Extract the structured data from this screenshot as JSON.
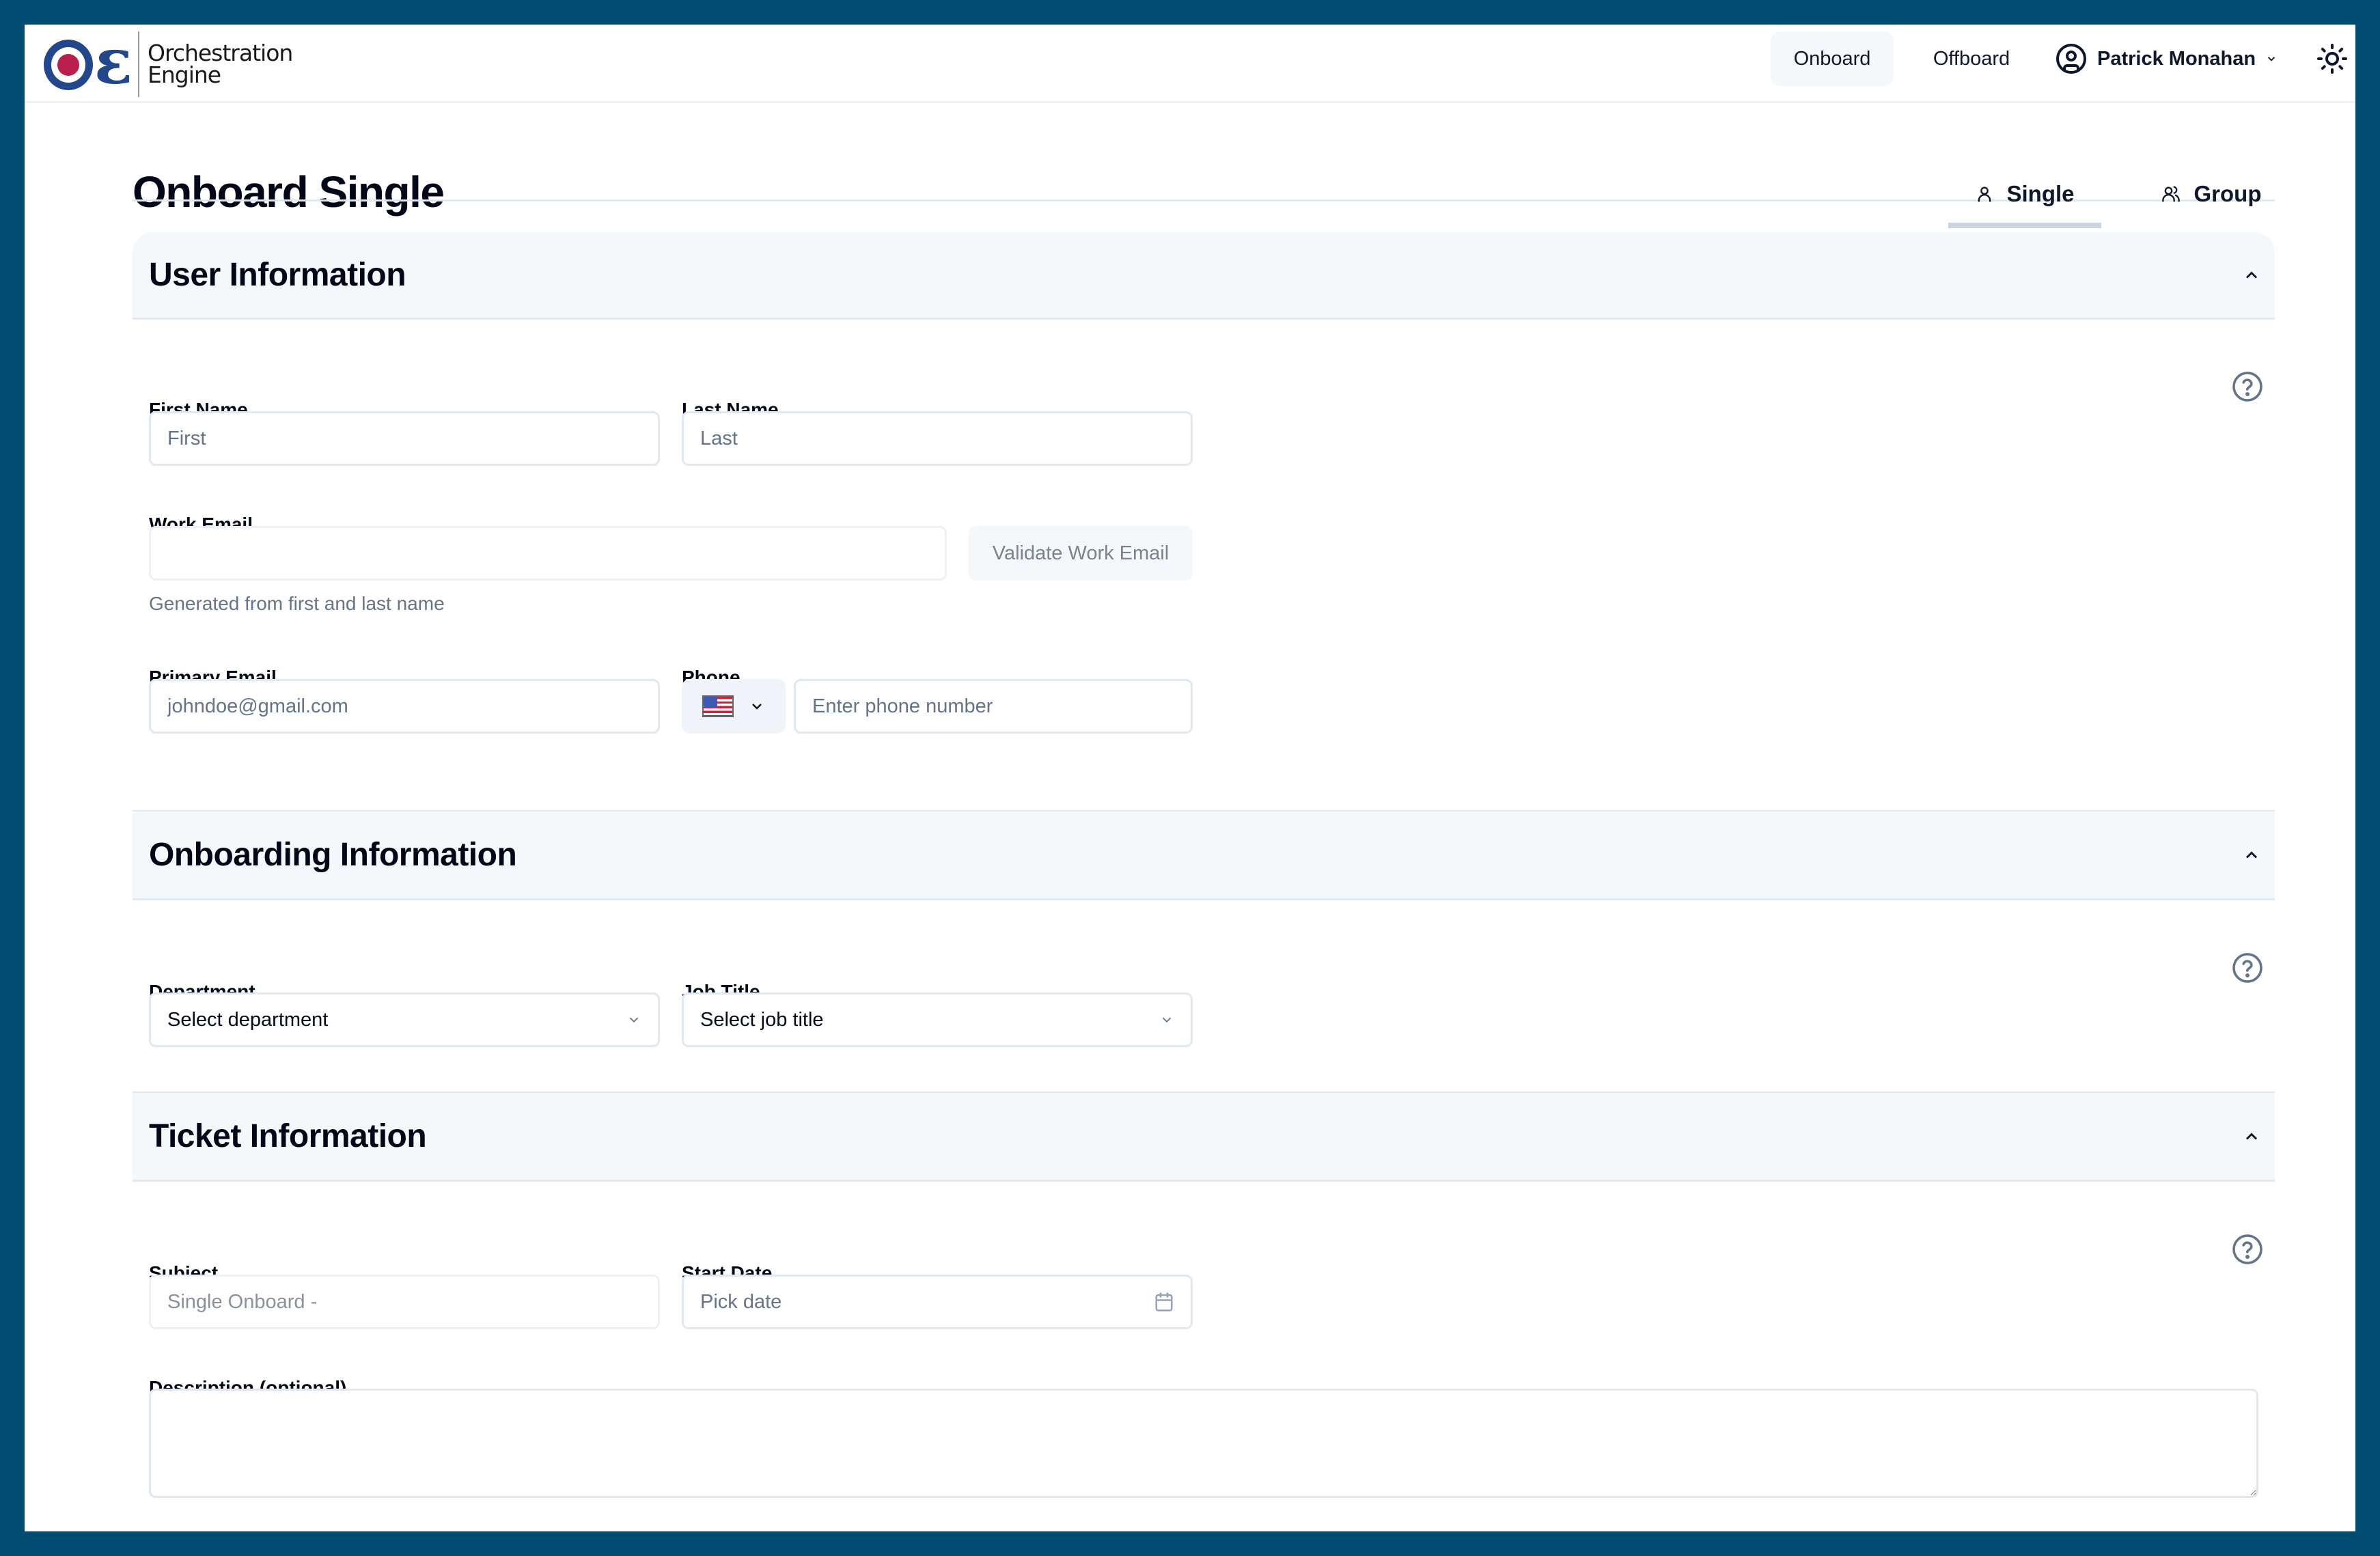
{
  "app": {
    "logo_line1": "Orchestration",
    "logo_line2": "Engine",
    "brand_colors": {
      "frame": "#014d72",
      "logo_blue": "#22478a",
      "logo_red": "#b81f4b"
    }
  },
  "nav": {
    "onboard": "Onboard",
    "offboard": "Offboard",
    "user_name": "Patrick Monahan",
    "user_chevron": "⌄"
  },
  "page": {
    "title": "Onboard Single",
    "tabs": [
      {
        "label": "Single",
        "icon": "user-icon",
        "active": true
      },
      {
        "label": "Group",
        "icon": "users-icon",
        "active": false
      }
    ]
  },
  "user_info": {
    "title": "User Information",
    "first_name": {
      "label": "First Name",
      "placeholder": "First",
      "value": ""
    },
    "last_name": {
      "label": "Last Name",
      "placeholder": "Last",
      "value": ""
    },
    "work_email": {
      "label": "Work Email",
      "value": "",
      "validate_label": "Validate Work Email",
      "helper": "Generated from first and last name"
    },
    "primary_email": {
      "label": "Primary Email",
      "placeholder": "johndoe@gmail.com",
      "value": ""
    },
    "phone": {
      "label": "Phone",
      "country": "US",
      "placeholder": "Enter phone number",
      "value": ""
    }
  },
  "onboarding_info": {
    "title": "Onboarding Information",
    "department": {
      "label": "Department",
      "selected": "Select department"
    },
    "job_title": {
      "label": "Job Title",
      "selected": "Select job title"
    }
  },
  "ticket_info": {
    "title": "Ticket Information",
    "subject": {
      "label": "Subject",
      "placeholder": "Single Onboard -",
      "value": ""
    },
    "start_date": {
      "label": "Start Date",
      "placeholder": "Pick date"
    },
    "description": {
      "label": "Description (optional)",
      "value": ""
    }
  }
}
